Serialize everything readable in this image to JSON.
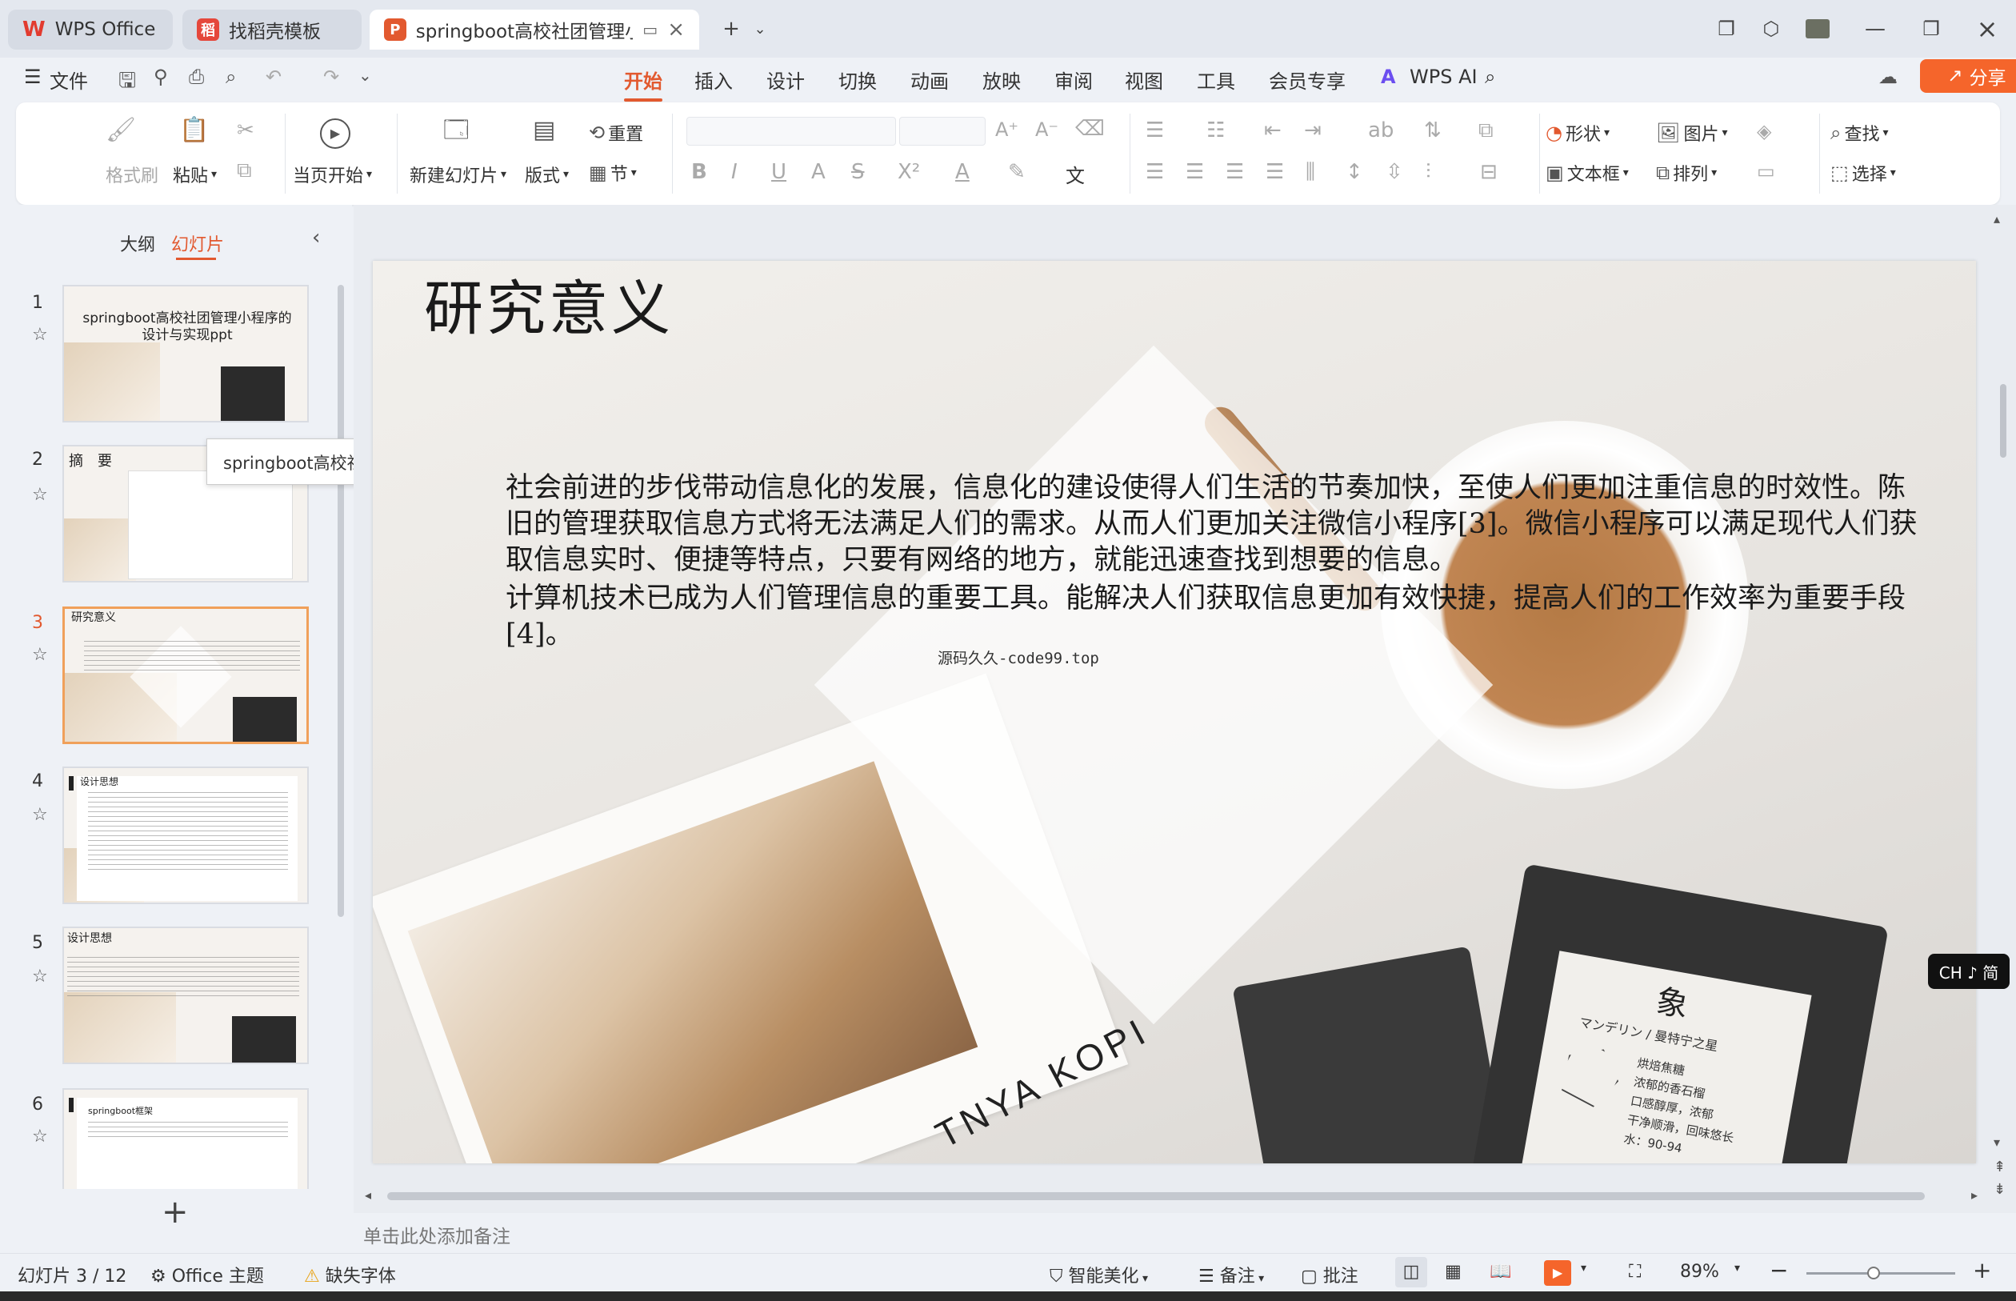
{
  "tabs": [
    {
      "label": "WPS Office"
    },
    {
      "label": "找稻壳模板"
    },
    {
      "label": "springboot高校社团管理小程"
    }
  ],
  "menu": {
    "file": "文件",
    "items": [
      "开始",
      "插入",
      "设计",
      "切换",
      "动画",
      "放映",
      "审阅",
      "视图",
      "工具",
      "会员专享"
    ],
    "wps_ai": "WPS AI",
    "share": "分享"
  },
  "ribbon": {
    "format_painter": "格式刷",
    "paste": "粘贴",
    "from_current": "当页开始",
    "new_slide": "新建幻灯片",
    "layout": "版式",
    "reset": "重置",
    "section": "节",
    "shape": "形状",
    "picture": "图片",
    "textbox": "文本框",
    "arrange": "排列",
    "find": "查找",
    "select": "选择"
  },
  "left_panel": {
    "tab_outline": "大纲",
    "tab_slides": "幻灯片",
    "tooltip": "springboot高校社...",
    "thumbs": [
      {
        "num": "1",
        "title": "springboot高校社团管理小程序的设计与实现ppt"
      },
      {
        "num": "2",
        "title": "摘　要"
      },
      {
        "num": "3",
        "title": "研究意义"
      },
      {
        "num": "4",
        "title": "设计思想"
      },
      {
        "num": "5",
        "title": "设计思想"
      },
      {
        "num": "6",
        "title": "springboot框架"
      }
    ]
  },
  "slide": {
    "title": "研究意义",
    "body1": "社会前进的步伐带动信息化的发展，信息化的建设使得人们生活的节奏加快，至使人们更加注重信息的时效性。陈旧的管理获取信息方式将无法满足人们的需求。从而人们更加关注微信小程序[3]。微信小程序可以满足现代人们获取信息实时、便捷等特点，只要有网络的地方，就能迅速查找到想要的信息。",
    "body2": "计算机技术已成为人们管理信息的重要工具。能解决人们获取信息更加有效快捷，提高人们的工作效率为重要手段[4]。",
    "watermark": "源码久久-code99.top",
    "photo_text": "TNYA KOPI",
    "package_char": "象",
    "package_line1": "マンデリン / 曼特宁之星",
    "package_line2": "烘焙焦糖",
    "package_line3": "浓郁的香石榴",
    "package_line4": "口感醇厚，浓郁",
    "package_line5": "干净顺滑，回味悠长",
    "package_line6": "水：90-94"
  },
  "ime": "CH ♪ 简",
  "notes_placeholder": "单击此处添加备注",
  "status": {
    "slide_count": "幻灯片 3 / 12",
    "theme": "Office 主题",
    "missing_font": "缺失字体",
    "beautify": "智能美化",
    "notes": "备注",
    "comments": "批注",
    "zoom": "89%"
  },
  "colors": {
    "accent": "#e2592f",
    "share_bg": "#f5652b"
  }
}
